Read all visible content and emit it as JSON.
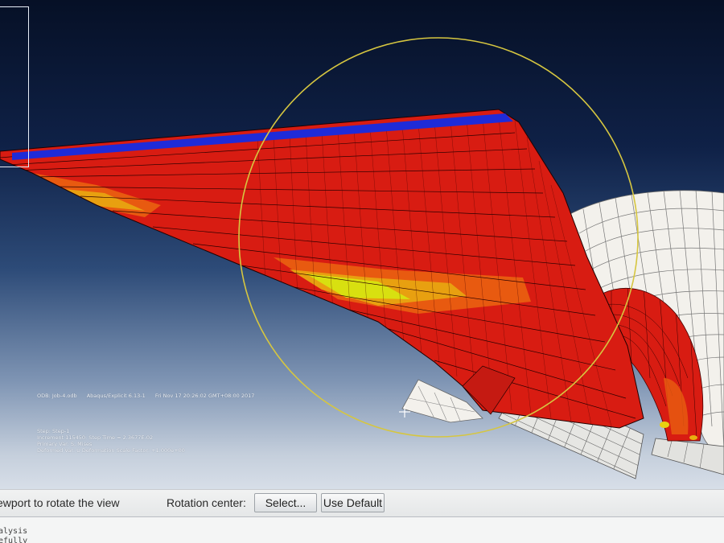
{
  "odb_info": {
    "odb": "ODB: Job-4.odb",
    "solver": "Abaqus/Explicit 6.13-1",
    "date": "Fri Nov 17 20:26:02 GMT+08:00 2017",
    "step": "Step: Step-1",
    "increment": "Increment   115450: Step Time =    2.3677E-02",
    "primary_var": "Primary Var: S, Mises",
    "deformed_var": "Deformed Var: U   Deformation Scale Factor: +1.000e+00"
  },
  "prompt": {
    "text": "ewport to rotate the view",
    "rotation_center_label": "Rotation center:",
    "select_button": "Select...",
    "use_default_button": "Use Default"
  },
  "message_area": {
    "line1": "alysis",
    "line2": "efully"
  },
  "colors": {
    "contour_red": "#d81c12",
    "contour_orange": "#e85a10",
    "contour_yellow": "#d8e010",
    "contour_blue": "#1f2bd8",
    "rotation_circle": "#d6c640",
    "mesh_white": "#f3f1ec"
  },
  "icons": {
    "rotation_pivot": "cross-icon"
  }
}
